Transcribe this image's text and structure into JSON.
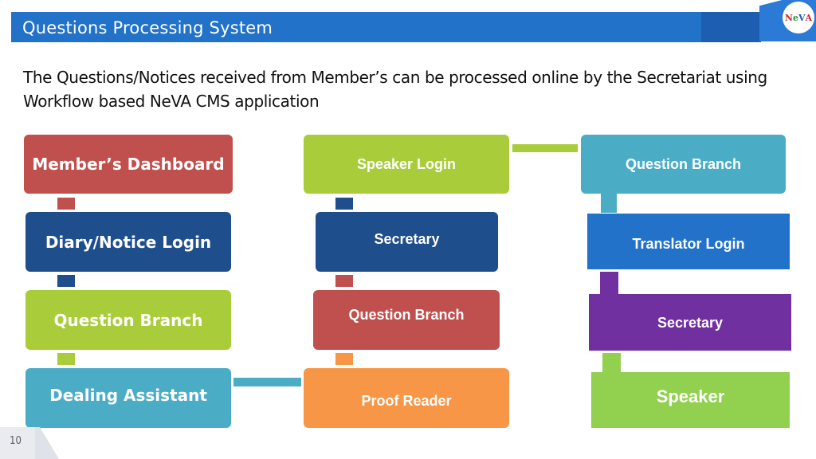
{
  "header": {
    "title": "Questions Processing System",
    "logo": {
      "n": "N",
      "e": "e",
      "v": "V",
      "a": "A"
    }
  },
  "description": "The Questions/Notices received from Member’s can be processed online by the Secretariat using Workflow based NeVA CMS application",
  "flow": {
    "column1": [
      {
        "label": "Member’s Dashboard",
        "color": "#c0504d"
      },
      {
        "label": "Diary/Notice Login",
        "color": "#1f4e8c"
      },
      {
        "label": "Question Branch",
        "color": "#a9cd3a"
      },
      {
        "label": "Dealing Assistant",
        "color": "#4bacc6"
      }
    ],
    "column2": [
      {
        "label": "Speaker Login",
        "color": "#a9cd3a"
      },
      {
        "label": "Secretary",
        "color": "#1f4e8c"
      },
      {
        "label": "Question Branch",
        "color": "#c0504d"
      },
      {
        "label": "Proof Reader",
        "color": "#f79646"
      }
    ],
    "column3": [
      {
        "label": "Question Branch",
        "color": "#4bacc6"
      },
      {
        "label": "Translator Login",
        "color": "#2272c9"
      },
      {
        "label": "Secretary",
        "color": "#7030a0"
      },
      {
        "label": "Speaker",
        "color": "#92d050"
      }
    ]
  },
  "footer": {
    "page_number": "10"
  }
}
